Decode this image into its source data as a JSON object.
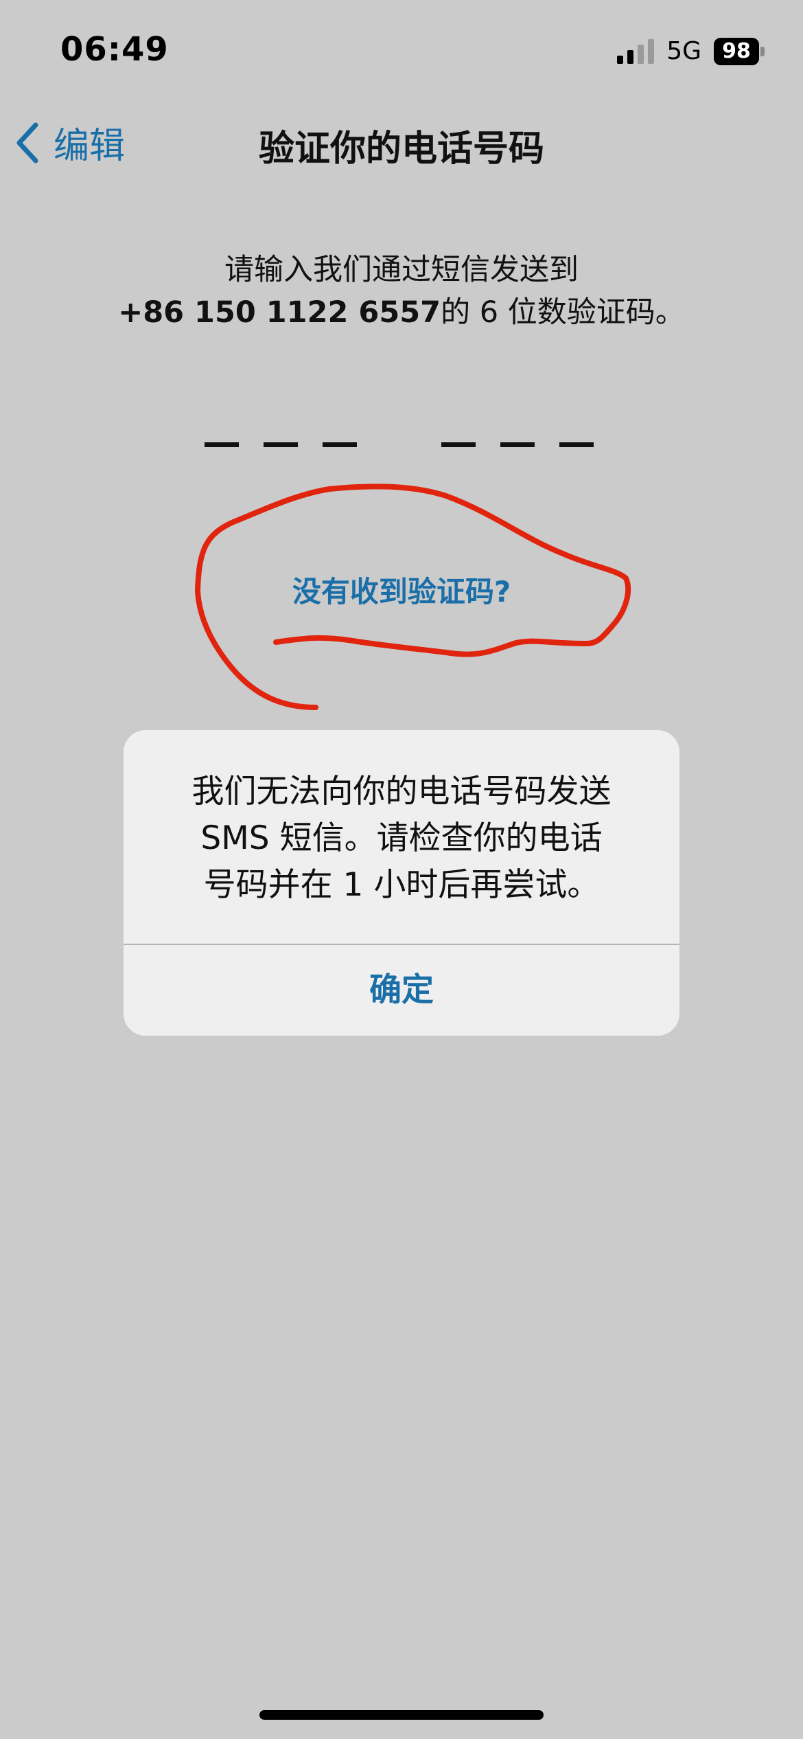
{
  "status_bar": {
    "time": "06:49",
    "network": "5G",
    "battery": "98"
  },
  "nav": {
    "back_label": "编辑",
    "title": "验证你的电话号码"
  },
  "instructions": {
    "line1": "请输入我们通过短信发送到",
    "phone_number": "+86 150 1122 6557",
    "line2_suffix": "的 6 位数验证码。"
  },
  "code_input": {
    "digits": [
      "",
      "",
      "",
      "",
      "",
      ""
    ]
  },
  "resend_link": "没有收到验证码?",
  "alert": {
    "message_line1": "我们无法向你的电话号码发送",
    "message_line2": "SMS 短信。请检查你的电话",
    "message_line3": "号码并在 1 小时后再尝试。",
    "ok_label": "确定"
  },
  "colors": {
    "accent": "#1a6fa8",
    "background": "#cbcbcb",
    "annotation": "#e0240e"
  }
}
